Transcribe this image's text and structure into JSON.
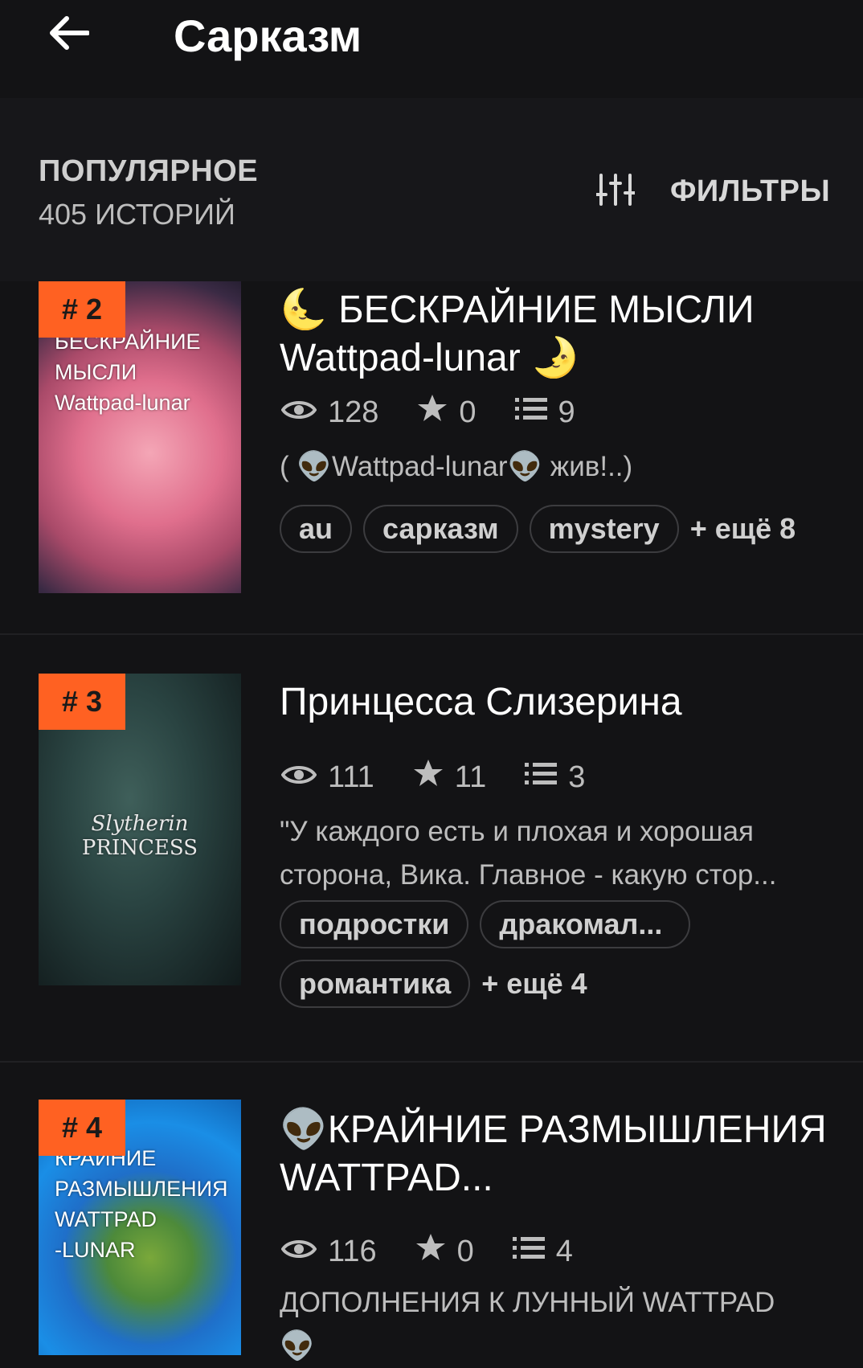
{
  "header": {
    "title": "Сарказм",
    "back_icon": "arrow-left-icon"
  },
  "subheader": {
    "sort": "ПОПУЛЯРНОЕ",
    "count": "405 ИСТОРИЙ",
    "filters_label": "ФИЛЬТРЫ",
    "filters_icon": "sliders-icon"
  },
  "colors": {
    "accent": "#ff6122",
    "background": "#131315"
  },
  "stories": [
    {
      "rank": "# 2",
      "cover_text": [
        "БЕСКРАЙНИЕ",
        "МЫСЛИ",
        "Wattpad-lunar"
      ],
      "title": "🌜 БЕСКРАЙНИЕ МЫСЛИ Wattpad-lunar 🌛",
      "views": "128",
      "votes": "0",
      "parts": "9",
      "description": "( 👽Wattpad-lunar👽 жив!..)",
      "tags": [
        "au",
        "сарказм",
        "mystery"
      ],
      "more": "+ ещё 8"
    },
    {
      "rank": "# 3",
      "cover_text": [
        "Slytherin",
        "PRINCESS"
      ],
      "title": "Принцесса Слизерина",
      "views": "111",
      "votes": "11",
      "parts": "3",
      "description": "\"У каждого есть и плохая и хорошая сторона, Вика. Главное - какую стор...",
      "tags": [
        "подростки",
        "дракомал...",
        "романтика"
      ],
      "more": "+ ещё 4"
    },
    {
      "rank": "# 4",
      "cover_text": [
        "КРАЙНИЕ",
        "РАЗМЫШЛЕНИЯ",
        "WATTPAD",
        "-LUNAR"
      ],
      "title": "👽КРАЙНИЕ РАЗМЫШЛЕНИЯ WATTPAD...",
      "views": "116",
      "votes": "0",
      "parts": "4",
      "description": "ДОПОЛНЕНИЯ К ЛУННЫЙ WATTPAD 👽"
    }
  ]
}
